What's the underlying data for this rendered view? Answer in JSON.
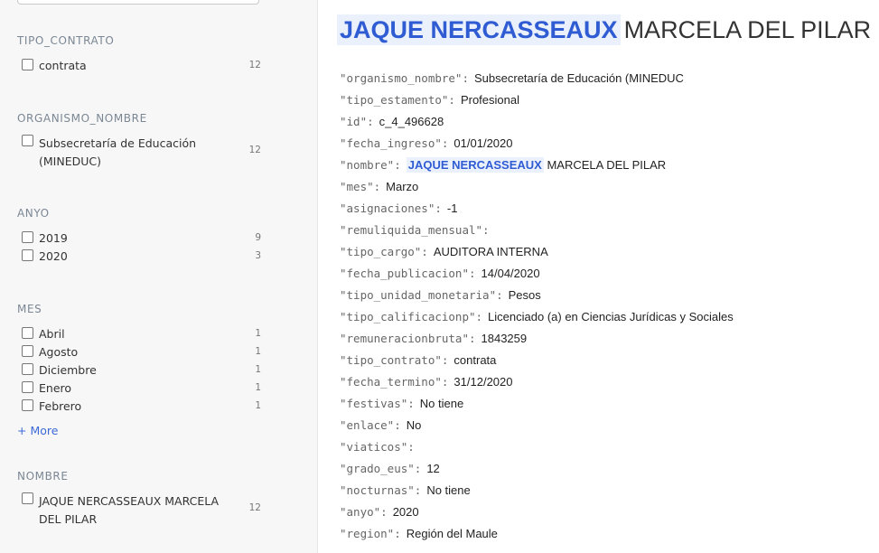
{
  "facets": {
    "tipo_contrato": {
      "title": "TIPO_CONTRATO",
      "items": [
        {
          "label": "contrata",
          "count": "12"
        }
      ]
    },
    "organismo_nombre": {
      "title": "ORGANISMO_NOMBRE",
      "items": [
        {
          "label": "Subsecretaría de Educación (MINEDUC)",
          "count": "12"
        }
      ]
    },
    "anyo": {
      "title": "ANYO",
      "items": [
        {
          "label": "2019",
          "count": "9"
        },
        {
          "label": "2020",
          "count": "3"
        }
      ]
    },
    "mes": {
      "title": "MES",
      "items": [
        {
          "label": "Abril",
          "count": "1"
        },
        {
          "label": "Agosto",
          "count": "1"
        },
        {
          "label": "Diciembre",
          "count": "1"
        },
        {
          "label": "Enero",
          "count": "1"
        },
        {
          "label": "Febrero",
          "count": "1"
        }
      ],
      "more_label": "+ More"
    },
    "nombre": {
      "title": "NOMBRE",
      "items": [
        {
          "label": "JAQUE NERCASSEAUX MARCELA DEL PILAR",
          "count": "12"
        }
      ]
    }
  },
  "record": {
    "title_highlight": "JAQUE NERCASSEAUX",
    "title_rest": "MARCELA DEL PILAR",
    "fields": [
      {
        "key": "\"organismo_nombre\":",
        "value": "Subsecretaría de Educación (MINEDUC"
      },
      {
        "key": "\"tipo_estamento\":",
        "value": "Profesional"
      },
      {
        "key": "\"id\":",
        "value": "c_4_496628"
      },
      {
        "key": "\"fecha_ingreso\":",
        "value": "01/01/2020"
      },
      {
        "key": "\"nombre\":",
        "value": "MARCELA DEL PILAR",
        "highlight": "JAQUE NERCASSEAUX"
      },
      {
        "key": "\"mes\":",
        "value": "Marzo"
      },
      {
        "key": "\"asignaciones\":",
        "value": "-1"
      },
      {
        "key": "\"remuliquida_mensual\":",
        "value": ""
      },
      {
        "key": "\"tipo_cargo\":",
        "value": "AUDITORA INTERNA"
      },
      {
        "key": "\"fecha_publicacion\":",
        "value": "14/04/2020"
      },
      {
        "key": "\"tipo_unidad_monetaria\":",
        "value": "Pesos"
      },
      {
        "key": "\"tipo_calificacionp\":",
        "value": "Licenciado (a) en Ciencias Jurídicas y Sociales"
      },
      {
        "key": "\"remuneracionbruta\":",
        "value": "1843259"
      },
      {
        "key": "\"tipo_contrato\":",
        "value": "contrata"
      },
      {
        "key": "\"fecha_termino\":",
        "value": "31/12/2020"
      },
      {
        "key": "\"festivas\":",
        "value": "No tiene"
      },
      {
        "key": "\"enlace\":",
        "value": "No"
      },
      {
        "key": "\"viaticos\":",
        "value": ""
      },
      {
        "key": "\"grado_eus\":",
        "value": "12"
      },
      {
        "key": "\"nocturnas\":",
        "value": "No tiene"
      },
      {
        "key": "\"anyo\":",
        "value": "2020"
      },
      {
        "key": "\"region\":",
        "value": "Región del Maule"
      }
    ]
  },
  "colors": {
    "accent": "#2f5bd3",
    "highlight_bg": "#eaf1fc",
    "sidebar_bg": "#f7f7f7"
  }
}
